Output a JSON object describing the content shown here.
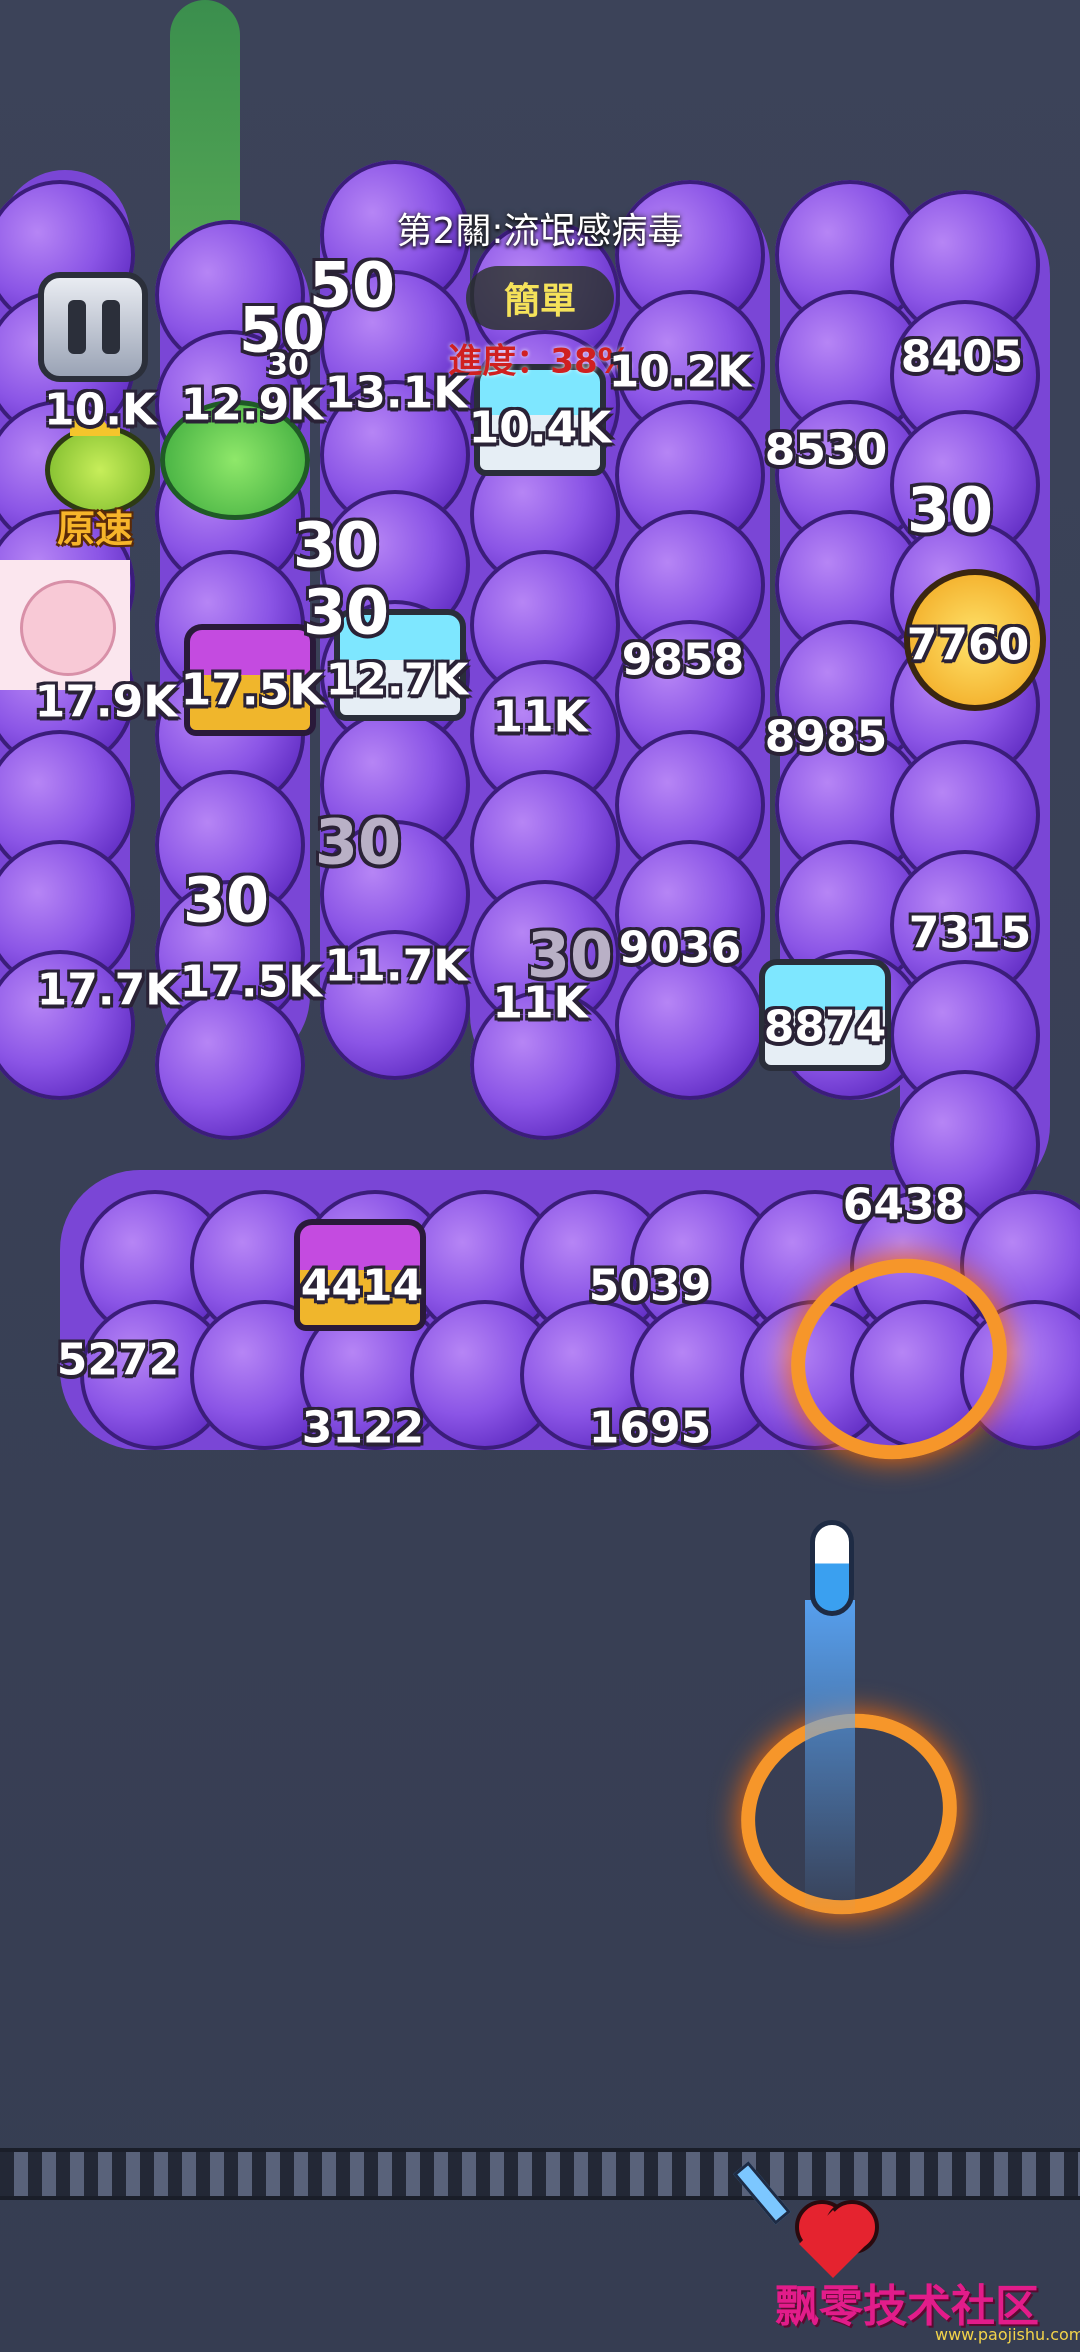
{
  "level": {
    "title": "第2關:流氓感病毒",
    "difficulty": "簡單",
    "progress_label": "進度：38%",
    "progress": 0.38
  },
  "hud": {
    "pause_icon": "pause-icon",
    "speed_label": "原速"
  },
  "colors": {
    "background": "#3a4156",
    "virus": "#8b55e6",
    "progress_text": "#d02020",
    "difficulty_text": "#f5e25a"
  },
  "hp_numbers": [
    "8405",
    "10.2K",
    "8530",
    "10.4K",
    "13.1K",
    "12.9K",
    "10.K",
    "7760",
    "9858",
    "8985",
    "12.7K",
    "17.5K",
    "17.9K",
    "11K",
    "7315",
    "9036",
    "11.7K",
    "17.5K",
    "17.7K",
    "11K",
    "8874",
    "6438",
    "4414",
    "5039",
    "5272",
    "3122",
    "1695"
  ],
  "damage_numbers": [
    "50",
    "50",
    "30",
    "30",
    "30",
    "30",
    "30",
    "30",
    "30"
  ],
  "watermark": "飘零技术社区",
  "watermark_url": "www.paojishu.com"
}
